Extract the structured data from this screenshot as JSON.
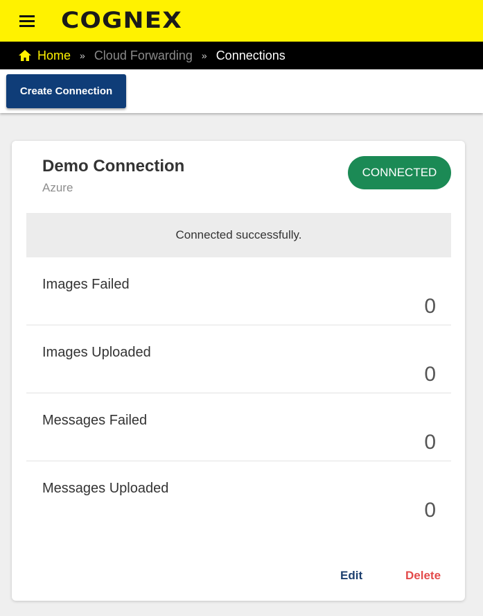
{
  "header": {
    "logo_text": "COGNEX",
    "menu_icon": "menu-icon",
    "bg_color": "#fff200"
  },
  "breadcrumb": {
    "home_icon": "home-icon",
    "home_label": "Home",
    "separator": "»",
    "middle_label": "Cloud Forwarding",
    "current_label": "Connections"
  },
  "toolbar": {
    "create_label": "Create Connection",
    "button_color": "#0f3d78"
  },
  "connection": {
    "name": "Demo Connection",
    "provider": "Azure",
    "status": "CONNECTED",
    "status_color": "#1b8a55",
    "message": "Connected successfully.",
    "stats": [
      {
        "label": "Images Failed",
        "value": "0"
      },
      {
        "label": "Images Uploaded",
        "value": "0"
      },
      {
        "label": "Messages Failed",
        "value": "0"
      },
      {
        "label": "Messages Uploaded",
        "value": "0"
      }
    ],
    "edit_label": "Edit",
    "delete_label": "Delete",
    "delete_color": "#e34a4a"
  }
}
